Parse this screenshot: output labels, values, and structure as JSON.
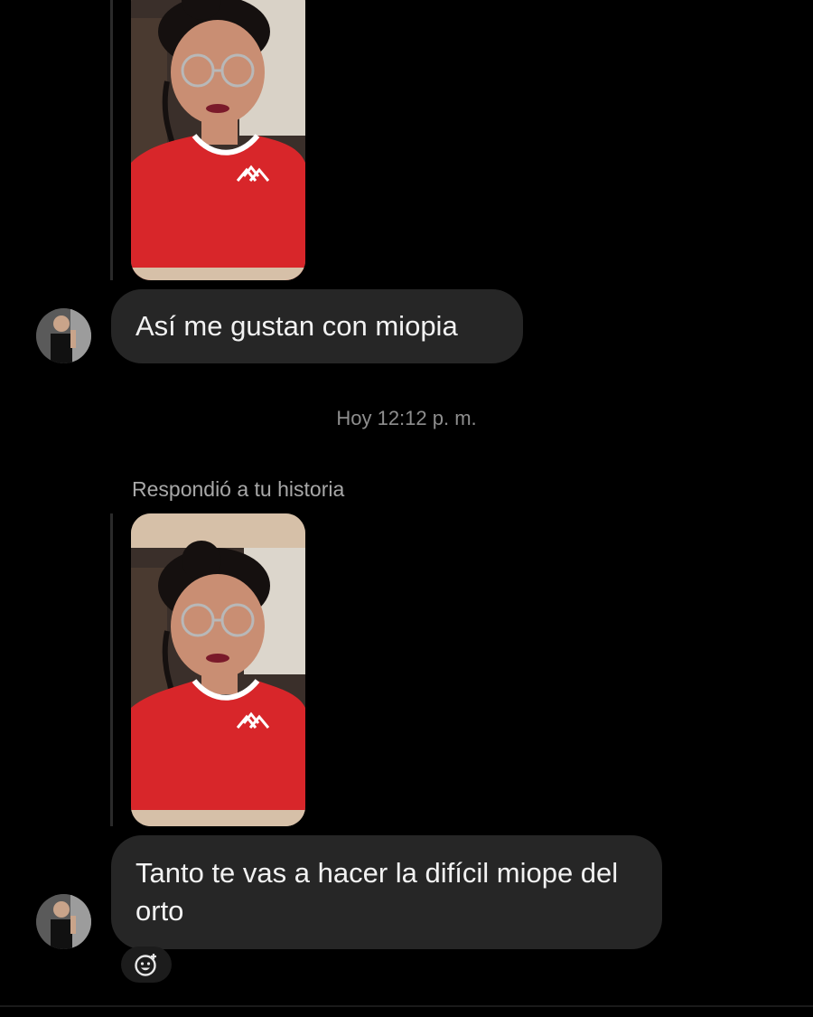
{
  "messages": [
    {
      "type": "story_reply",
      "text": "Así me gustan con miopia"
    },
    {
      "type": "story_reply",
      "reply_label": "Respondió a tu historia",
      "text": "Tanto te vas a hacer la difícil miope del orto"
    }
  ],
  "timestamp": "Hoy 12:12 p. m.",
  "icons": {
    "avatar": "user-avatar-icon",
    "react": "add-reaction-icon",
    "story": "story-photo"
  },
  "colors": {
    "background": "#000000",
    "bubble": "#262626",
    "secondary_text": "#8e8e8e",
    "shirt": "#d8262a"
  }
}
